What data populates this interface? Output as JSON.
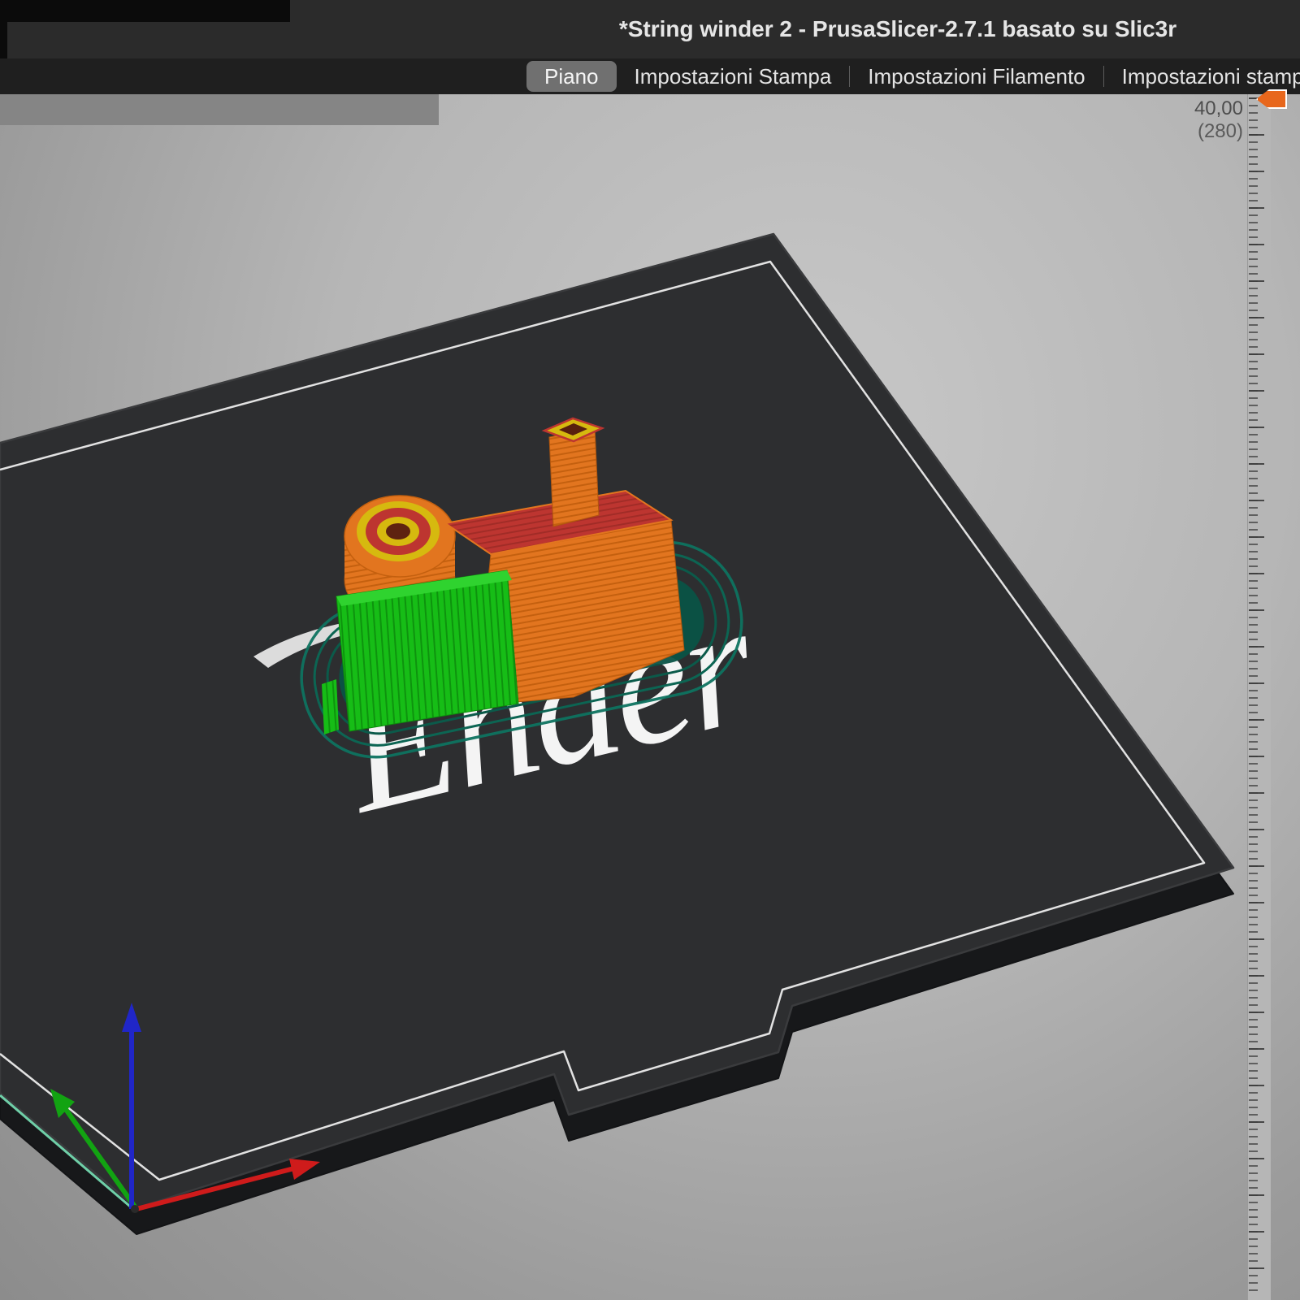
{
  "window": {
    "title": "*String winder 2 - PrusaSlicer-2.7.1 basato su Slic3r"
  },
  "tabs": [
    {
      "label": "Piano",
      "selected": true
    },
    {
      "label": "Impostazioni Stampa",
      "selected": false
    },
    {
      "label": "Impostazioni Filamento",
      "selected": false
    },
    {
      "label": "Impostazioni stampante",
      "selected": false
    }
  ],
  "layer_slider": {
    "value": "40,00",
    "layer_count": "(280)",
    "handle_icon": "layer-marker-icon"
  },
  "viewport": {
    "bed_logo": "Ender"
  },
  "colors": {
    "accent_orange": "#E8671C",
    "model_orange": "#E2751F",
    "support_green": "#16BD16",
    "top_fill_red": "#BD3530",
    "brim_teal": "#0B5A4A",
    "bed_surface": "#2D2E30",
    "axis_x_red": "#CF1B1B",
    "axis_y_green": "#12A312",
    "axis_z_blue": "#2026C8"
  }
}
